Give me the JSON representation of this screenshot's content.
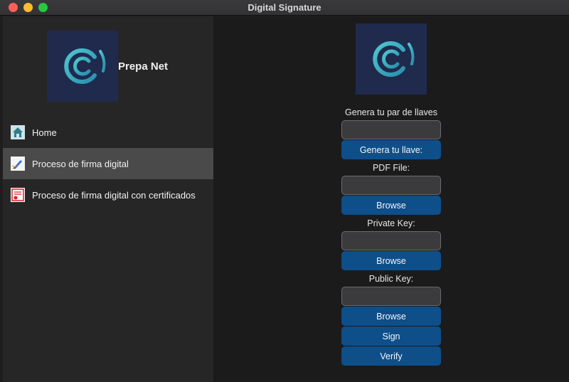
{
  "window": {
    "title": "Digital Signature"
  },
  "sidebar": {
    "brand_name": "Prepa Net",
    "items": [
      {
        "label": "Home",
        "icon": "home-icon"
      },
      {
        "label": "Proceso de firma digital",
        "icon": "pen-sign-icon"
      },
      {
        "label": "Proceso de firma digital con certificados",
        "icon": "certificate-icon"
      }
    ],
    "active_index": 1
  },
  "form": {
    "keypair_label": "Genera tu par de llaves",
    "keypair_value": "",
    "keypair_button": "Genera tu llave:",
    "pdf_label": "PDF File:",
    "pdf_value": "",
    "pdf_button": "Browse",
    "private_label": "Private Key:",
    "private_value": "",
    "private_button": "Browse",
    "public_label": "Public Key:",
    "public_value": "",
    "public_button": "Browse",
    "sign_button": "Sign",
    "verify_button": "Verify"
  },
  "colors": {
    "button": "#0e4f8a",
    "logo_bg": "#1f2a4d",
    "logo_ring": "#3fb8c4",
    "active_item": "#4a4a4a"
  }
}
